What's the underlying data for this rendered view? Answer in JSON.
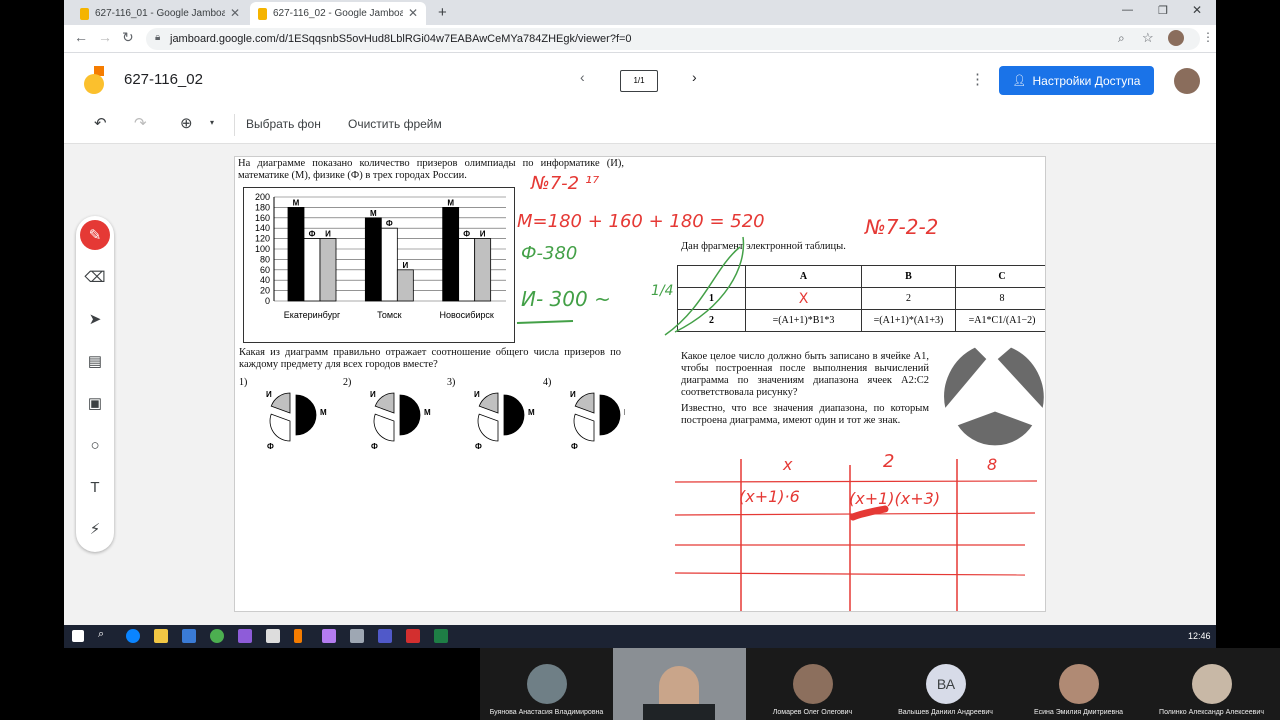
{
  "browser": {
    "tabs": [
      {
        "title": "627-116_01 - Google Jamboard"
      },
      {
        "title": "627-116_02 - Google Jamboard"
      }
    ],
    "url": "jamboard.google.com/d/1ESqqsnbS5ovHud8LblRGi04w7EABAwCeMYa784ZHEgk/viewer?f=0",
    "new_tab": "+"
  },
  "jam": {
    "title": "627-116_02",
    "frame_counter": "1/1",
    "share_button": "Настройки Доступа",
    "toolbar": {
      "set_bg": "Выбрать фон",
      "clear_frame": "Очистить фрейм"
    }
  },
  "task1": {
    "intro": "На диаграмме показано количество призеров олимпиады по информатике (И), математике (М), физике (Ф) в трех городах России.",
    "question": "Какая из диаграмм правильно отражает соотношение общего числа призеров по каждому предмету для всех городов вместе?",
    "options": [
      "1)",
      "2)",
      "3)",
      "4)"
    ],
    "pie_labels": {
      "i": "И",
      "m": "М",
      "f": "Ф"
    }
  },
  "chart_data": {
    "type": "bar",
    "categories": [
      "Екатеринбург",
      "Томск",
      "Новосибирск"
    ],
    "series": [
      {
        "name": "М",
        "values": [
          180,
          160,
          180
        ]
      },
      {
        "name": "Ф",
        "values": [
          120,
          140,
          120
        ]
      },
      {
        "name": "И",
        "values": [
          120,
          60,
          120
        ]
      }
    ],
    "ylim": [
      0,
      200
    ],
    "yticks": [
      0,
      20,
      40,
      60,
      80,
      100,
      120,
      140,
      160,
      180,
      200
    ],
    "colors": {
      "М": "#000000",
      "Ф": "#ffffff",
      "И": "#c0c0c0"
    }
  },
  "task2": {
    "intro": "Дан фрагмент электронной таблицы.",
    "headers": [
      "",
      "A",
      "B",
      "C"
    ],
    "rows": [
      [
        "1",
        "X",
        "2",
        "8"
      ],
      [
        "2",
        "=(A1+1)*B1*3",
        "=(A1+1)*(A1+3)",
        "=A1*C1/(A1−2)"
      ]
    ],
    "question": "Какое целое число должно быть записано в ячейке A1, чтобы построенная после выполнения вычислений диаграмма по значениям диапазона ячеек A2:C2 соответствовала рисунку?",
    "note": "Известно, что все значения диапазона, по которым построена диаграмма, имеют один и тот же знак."
  },
  "handwriting": {
    "n1": "№7-2 ¹⁷",
    "m": "М=180 + 160 + 180 = 520",
    "f": "Ф-380",
    "i": "И- 300 ~",
    "quarter": "1/4",
    "n2": "№7-2-2",
    "cols": [
      "x",
      "2",
      "8"
    ],
    "cells": [
      "(x+1)·6",
      "(x+1)(x+3)"
    ]
  },
  "taskbar": {
    "time": "12:46"
  },
  "participants": [
    {
      "name": "Буянова Анастасия Владимировна"
    },
    {
      "name": ""
    },
    {
      "name": "Ломарев Олег Олегович"
    },
    {
      "name": "Валышев Даниил Андреевич",
      "initials": "ВА"
    },
    {
      "name": "Есина Эмилия Дмитриевна"
    },
    {
      "name": "Полинко Александр Алексеевич"
    }
  ]
}
